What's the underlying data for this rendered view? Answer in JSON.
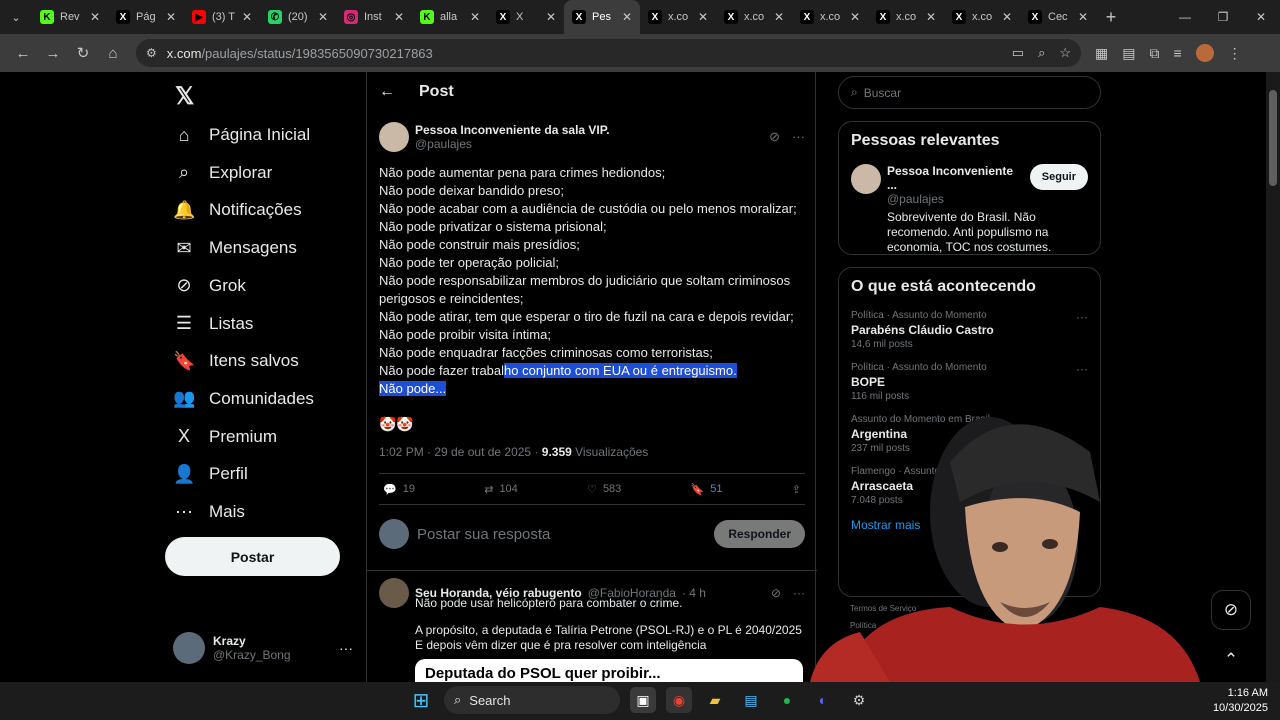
{
  "browser": {
    "tabs": [
      {
        "title": "Rev",
        "favicon_color": "#53fc18",
        "glyph": "K"
      },
      {
        "title": "Pág",
        "favicon_color": "#000000",
        "glyph": "X"
      },
      {
        "title": "(3) T",
        "favicon_color": "#ff0000",
        "glyph": "▶"
      },
      {
        "title": "(20)",
        "favicon_color": "#25d366",
        "glyph": "✆"
      },
      {
        "title": "Inst",
        "favicon_color": "#d62976",
        "glyph": "◎"
      },
      {
        "title": "alla",
        "favicon_color": "#53fc18",
        "glyph": "K"
      },
      {
        "title": "X",
        "favicon_color": "#000000",
        "glyph": "X"
      },
      {
        "title": "Pes",
        "favicon_color": "#000000",
        "glyph": "X",
        "active": true
      },
      {
        "title": "x.co",
        "favicon_color": "#000000",
        "glyph": "X"
      },
      {
        "title": "x.co",
        "favicon_color": "#000000",
        "glyph": "X"
      },
      {
        "title": "x.co",
        "favicon_color": "#000000",
        "glyph": "X"
      },
      {
        "title": "x.co",
        "favicon_color": "#000000",
        "glyph": "X"
      },
      {
        "title": "x.co",
        "favicon_color": "#000000",
        "glyph": "X"
      },
      {
        "title": "Cec",
        "favicon_color": "#000000",
        "glyph": "X"
      }
    ],
    "url_host": "x.com",
    "url_path": "/paulajes/status/1983565090730217863"
  },
  "nav": {
    "items": [
      {
        "label": "Página Inicial",
        "icon": "⌂",
        "name": "home"
      },
      {
        "label": "Explorar",
        "icon": "⌕",
        "name": "explore"
      },
      {
        "label": "Notificações",
        "icon": "🔔",
        "name": "notifications"
      },
      {
        "label": "Mensagens",
        "icon": "✉",
        "name": "messages"
      },
      {
        "label": "Grok",
        "icon": "⊘",
        "name": "grok"
      },
      {
        "label": "Listas",
        "icon": "☰",
        "name": "lists"
      },
      {
        "label": "Itens salvos",
        "icon": "🔖",
        "name": "bookmarks"
      },
      {
        "label": "Comunidades",
        "icon": "👥",
        "name": "communities"
      },
      {
        "label": "Premium",
        "icon": "X",
        "name": "premium"
      },
      {
        "label": "Perfil",
        "icon": "👤",
        "name": "profile"
      },
      {
        "label": "Mais",
        "icon": "⋯",
        "name": "more"
      }
    ],
    "post_button": "Postar",
    "account": {
      "name": "Krazy",
      "handle": "@Krazy_Bong"
    }
  },
  "main": {
    "header_title": "Post",
    "tweet": {
      "author_name": "Pessoa Inconveniente da sala VIP.",
      "author_handle": "@paulajes",
      "lines": [
        "Não pode aumentar pena para crimes hediondos;",
        "Não pode deixar bandido preso;",
        "Não pode acabar com a audiência de custódia ou pelo menos moralizar;",
        "Não pode privatizar o sistema prisional;",
        "Não pode construir mais presídios;",
        "Não pode ter operação policial;",
        "Não pode responsabilizar membros do judiciário que soltam criminosos",
        "perigosos e reincidentes;",
        "Não pode atirar, tem que esperar o tiro de fuzil na cara e depois revidar;",
        "Não pode proibir visita íntima;",
        "Não pode enquadrar facções criminosas como terroristas;"
      ],
      "line_partial_plain": "Não pode fazer trabal",
      "line_partial_selected": "ho conjunto com EUA ou é entreguismo.",
      "line_last_selected": "Não pode...",
      "emojis": "🤡🤡",
      "time": "1:02 PM · 29 de out de 2025 · ",
      "views_count": "9.359",
      "views_label": " Visualizações",
      "replies": "19",
      "reposts": "104",
      "likes": "583",
      "bookmarks": "51"
    },
    "reply_placeholder": "Postar sua resposta",
    "reply_button": "Responder",
    "tweet2": {
      "author_name": "Seu Horanda, véio rabugento",
      "author_handle": "@FabioHoranda",
      "time": "· 4 h",
      "p1": "Não pode usar helicóptero para combater o crime.",
      "p2": "A propósito, a deputada é Talíria Petrone (PSOL-RJ) e o PL é 2040/2025",
      "p3": "E depois vêm dizer que é pra resolver com inteligência",
      "card_text": "Deputada do PSOL quer proibir..."
    }
  },
  "sidebar": {
    "search_placeholder": "Buscar",
    "relevant_title": "Pessoas relevantes",
    "relevant": {
      "name": "Pessoa Inconveniente ...",
      "handle": "@paulajes",
      "follow": "Seguir",
      "bio": "Sobrevivente do Brasil. Não recomendo. Anti populismo na economia, TOC nos costumes."
    },
    "trends_title": "O que está acontecendo",
    "trends": [
      {
        "cat": "Política · Assunto do Momento",
        "name": "Parabéns Cláudio Castro",
        "count": "14,6 mil posts"
      },
      {
        "cat": "Política · Assunto do Momento",
        "name": "BOPE",
        "count": "116 mil posts"
      },
      {
        "cat": "Assunto do Momento em Brasil",
        "name": "Argentina",
        "count": "237 mil posts"
      },
      {
        "cat": "Flamengo · Assunto do Momento",
        "name": "Arrascaeta",
        "count": "7.048 posts"
      }
    ],
    "show_more": "Mostrar mais",
    "footer": "Termos de Serviço",
    "footer2": "Política"
  },
  "taskbar": {
    "search_label": "Search",
    "time": "1:16 AM",
    "date": "10/30/2025"
  }
}
